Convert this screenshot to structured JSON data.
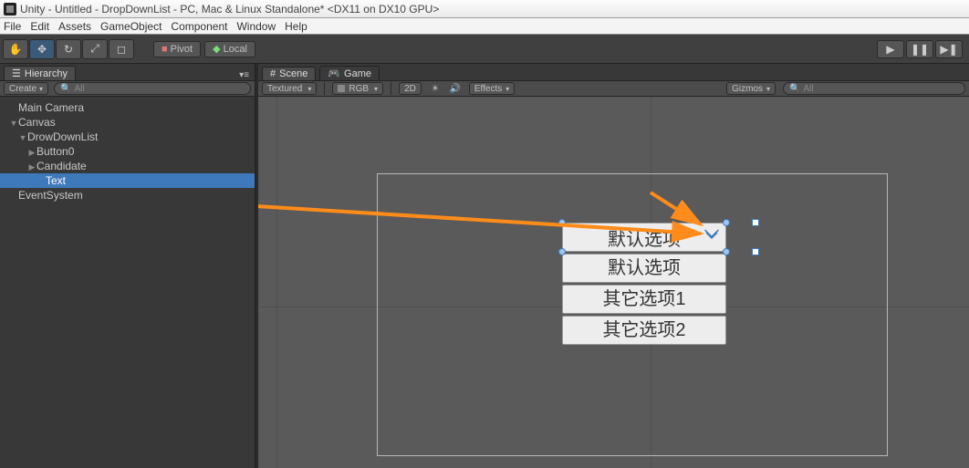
{
  "window": {
    "title": "Unity - Untitled - DropDownList - PC, Mac & Linux Standalone* <DX11 on DX10 GPU>"
  },
  "menu": {
    "file": "File",
    "edit": "Edit",
    "assets": "Assets",
    "gameobject": "GameObject",
    "component": "Component",
    "window": "Window",
    "help": "Help"
  },
  "toolbar": {
    "pivot": "Pivot",
    "local": "Local"
  },
  "hierarchy": {
    "title": "Hierarchy",
    "create": "Create",
    "search_placeholder": "All",
    "items": [
      {
        "label": "Main Camera",
        "indent": 1,
        "arrow": ""
      },
      {
        "label": "Canvas",
        "indent": 1,
        "arrow": "▼"
      },
      {
        "label": "DrowDownList",
        "indent": 2,
        "arrow": "▼"
      },
      {
        "label": "Button0",
        "indent": 3,
        "arrow": "▶"
      },
      {
        "label": "Candidate",
        "indent": 3,
        "arrow": "▶"
      },
      {
        "label": "Text",
        "indent": 4,
        "arrow": "",
        "selected": true
      },
      {
        "label": "EventSystem",
        "indent": 1,
        "arrow": ""
      }
    ]
  },
  "scene": {
    "tab_scene": "Scene",
    "tab_game": "Game",
    "shading": "Textured",
    "rgb": "RGB",
    "twod": "2D",
    "effects": "Effects",
    "gizmos": "Gizmos",
    "search_placeholder": "All"
  },
  "dropdown_ui": {
    "selected": "默认选项",
    "options": [
      "默认选项",
      "其它选项1",
      "其它选项2"
    ]
  }
}
